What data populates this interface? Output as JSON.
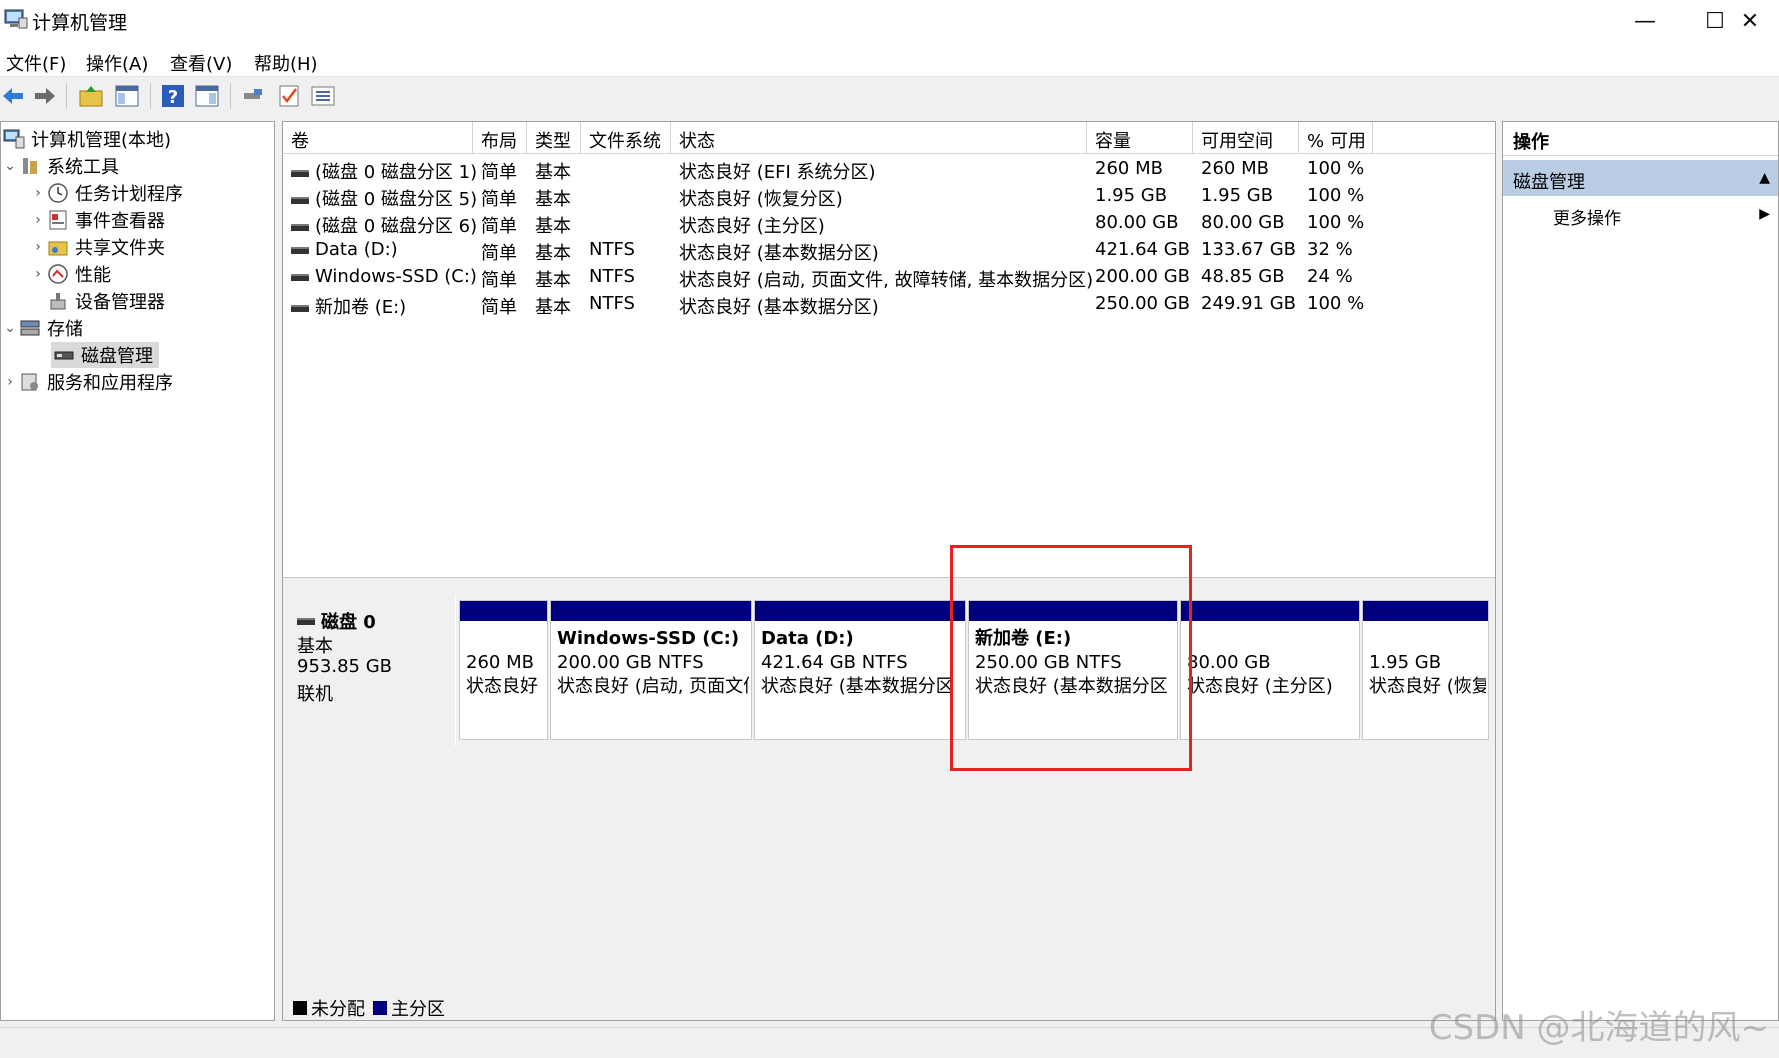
{
  "window": {
    "title": "计算机管理",
    "minimize": "—",
    "maximize": "☐",
    "close": "✕"
  },
  "menu": [
    "文件(F)",
    "操作(A)",
    "查看(V)",
    "帮助(H)"
  ],
  "toolbar_icons": [
    "back-arrow-icon",
    "forward-arrow-icon",
    "up-folder-icon",
    "show-hide-tree-icon",
    "help-icon",
    "properties-view-icon",
    "connect-icon",
    "check-icon",
    "list-icon"
  ],
  "tree": {
    "root": "计算机管理(本地)",
    "system_tools": "系统工具",
    "task_scheduler": "任务计划程序",
    "event_viewer": "事件查看器",
    "shared_folders": "共享文件夹",
    "performance": "性能",
    "device_manager": "设备管理器",
    "storage": "存储",
    "disk_management": "磁盘管理",
    "services_apps": "服务和应用程序"
  },
  "columns": [
    "卷",
    "布局",
    "类型",
    "文件系统",
    "状态",
    "容量",
    "可用空间",
    "% 可用"
  ],
  "volumes": [
    [
      "(磁盘 0 磁盘分区 1)",
      "简单",
      "基本",
      "",
      "状态良好 (EFI 系统分区)",
      "260 MB",
      "260 MB",
      "100 %"
    ],
    [
      "(磁盘 0 磁盘分区 5)",
      "简单",
      "基本",
      "",
      "状态良好 (恢复分区)",
      "1.95 GB",
      "1.95 GB",
      "100 %"
    ],
    [
      "(磁盘 0 磁盘分区 6)",
      "简单",
      "基本",
      "",
      "状态良好 (主分区)",
      "80.00 GB",
      "80.00 GB",
      "100 %"
    ],
    [
      "Data (D:)",
      "简单",
      "基本",
      "NTFS",
      "状态良好 (基本数据分区)",
      "421.64 GB",
      "133.67 GB",
      "32 %"
    ],
    [
      "Windows-SSD (C:)",
      "简单",
      "基本",
      "NTFS",
      "状态良好 (启动, 页面文件, 故障转储, 基本数据分区)",
      "200.00 GB",
      "48.85 GB",
      "24 %"
    ],
    [
      "新加卷 (E:)",
      "简单",
      "基本",
      "NTFS",
      "状态良好 (基本数据分区)",
      "250.00 GB",
      "249.91 GB",
      "100 %"
    ]
  ],
  "disk": {
    "name": "磁盘 0",
    "type": "基本",
    "size": "953.85 GB",
    "status": "联机"
  },
  "partitions": [
    {
      "name": "",
      "size": "260 MB",
      "status": "状态良好"
    },
    {
      "name": "Windows-SSD  (C:)",
      "size": "200.00 GB NTFS",
      "status": "状态良好 (启动, 页面文件"
    },
    {
      "name": "Data  (D:)",
      "size": "421.64 GB NTFS",
      "status": "状态良好 (基本数据分区"
    },
    {
      "name": "新加卷  (E:)",
      "size": "250.00 GB NTFS",
      "status": "状态良好 (基本数据分区"
    },
    {
      "name": "",
      "size": "80.00 GB",
      "status": "状态良好 (主分区)"
    },
    {
      "name": "",
      "size": "1.95 GB",
      "status": "状态良好 (恢复"
    }
  ],
  "legend": {
    "unallocated": "未分配",
    "primary": "主分区",
    "unallocated_color": "#000000",
    "primary_color": "#00007f"
  },
  "actions": {
    "title": "操作",
    "section": "磁盘管理",
    "more": "更多操作"
  },
  "watermark": "CSDN @北海道的风~",
  "colors": {
    "partition_bar": "#00007f",
    "highlight": "#e42222",
    "action_section": "#b9cde5"
  }
}
